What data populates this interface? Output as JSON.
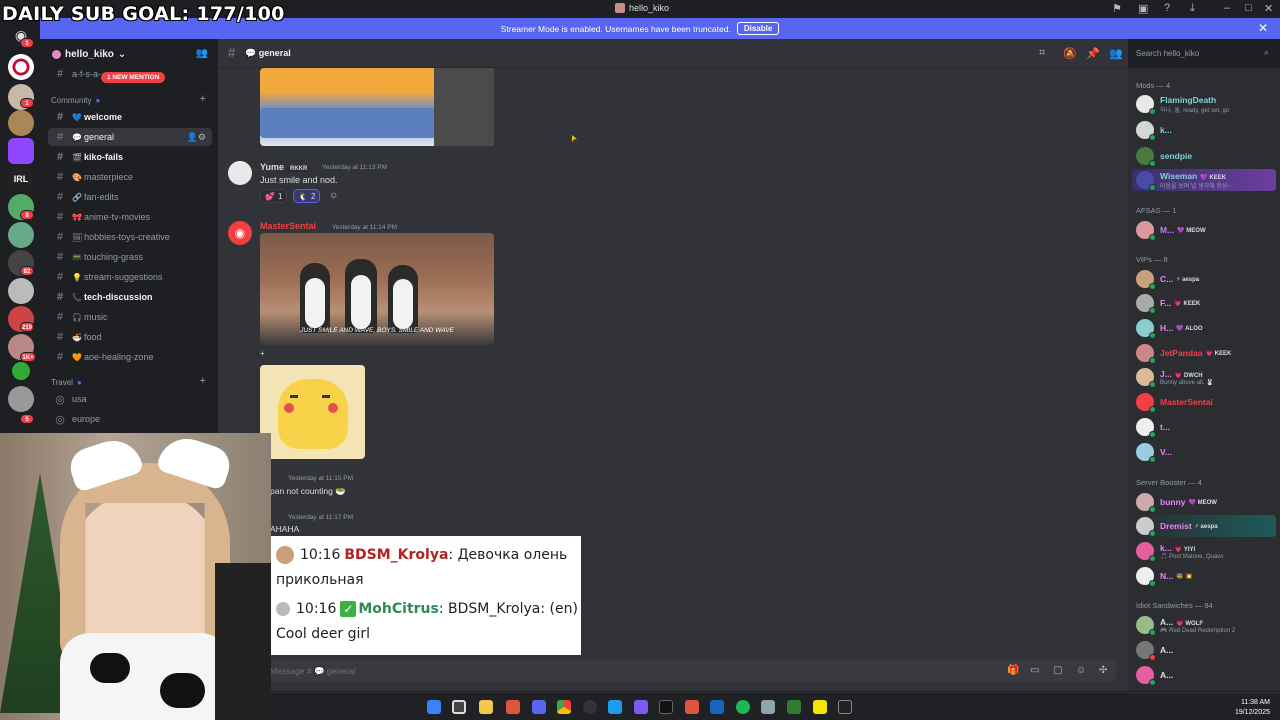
{
  "overlay_goal": "DAILY SUB GOAL: 177/100",
  "window": {
    "title": "hello_kiko"
  },
  "banner": {
    "text": "Streamer Mode is enabled. Usernames have been truncated.",
    "button": "Disable"
  },
  "server": {
    "name": "hello_kiko",
    "chevron": "⌄"
  },
  "sidebar": {
    "mention_pill": "1 NEW MENTION",
    "top_channel": "a-f-s-a-",
    "categories": {
      "community": "Community",
      "travel": "Travel"
    },
    "channels": [
      {
        "emoji": "💙",
        "label": "welcome"
      },
      {
        "emoji": "💬",
        "label": "general"
      },
      {
        "emoji": "🎬",
        "label": "kiko-fails"
      },
      {
        "emoji": "🎨",
        "label": "masterpiece"
      },
      {
        "emoji": "🔗",
        "label": "fan-edits"
      },
      {
        "emoji": "🎀",
        "label": "anime-tv-movies"
      },
      {
        "emoji": "🖼",
        "label": "hobbies-toys-creative"
      },
      {
        "emoji": "📟",
        "label": "touching-grass"
      },
      {
        "emoji": "💡",
        "label": "stream-suggestions"
      },
      {
        "emoji": "📞",
        "label": "tech-discussion"
      },
      {
        "emoji": "🎧",
        "label": "music"
      },
      {
        "emoji": "🍜",
        "label": "food"
      },
      {
        "emoji": "🧡",
        "label": "aoe-healing-zone"
      },
      {
        "emoji": "",
        "label": "usa"
      },
      {
        "emoji": "",
        "label": "europe"
      }
    ]
  },
  "server_badges": [
    "1",
    "1",
    "8",
    "82",
    "219",
    "1K+",
    "5"
  ],
  "channel_header": {
    "name": "general",
    "emoji": "💬"
  },
  "search": {
    "placeholder": "Search hello_kiko"
  },
  "messages": [
    {
      "name": "Yume",
      "tag": "RKKR",
      "time": "Yesterday at 11:13 PM",
      "text": "Just smile and nod.",
      "reactions": [
        {
          "emoji": "💕",
          "count": "1"
        },
        {
          "emoji": "🐧",
          "count": "2"
        }
      ]
    },
    {
      "name": "MasterSentai",
      "time": "Yesterday at 11:14 PM",
      "gif_caption": "JUST SMILE AND WAVE, BOYS. SMILE AND WAVE",
      "plus": "+"
    },
    {
      "time": "Yesterday at 11:15 PM",
      "text": "pan not counting 🥗"
    },
    {
      "time": "Yesterday at 11:17 PM",
      "text": "AHAHA"
    }
  ],
  "composer": {
    "placeholder": "Message # 💬 general"
  },
  "overlay_chat": [
    {
      "time": "10:16",
      "user": "BDSM_Krolya",
      "text": ": Девочка олень",
      "cont": "прикольная"
    },
    {
      "time": "10:16",
      "user": "MohCitrus",
      "text": ": BDSM_Krolya: (en)",
      "cont": "Cool deer girl"
    }
  ],
  "members": {
    "groups": [
      {
        "title": "Mods — 4"
      },
      {
        "title": "AFSAS — 1"
      },
      {
        "title": "VIPs — 8"
      },
      {
        "title": "Server Booster — 4"
      },
      {
        "title": "Idiot Sandwiches — 94"
      }
    ],
    "list": [
      {
        "name": "FlamingDeath",
        "sub": "하나, 둘, ready, get set, go",
        "color": "#7fd3d6",
        "avatar": "#e8e8e8"
      },
      {
        "name": "k...",
        "sub": "",
        "color": "#7fd3d6",
        "avatar": "#d6d6d6"
      },
      {
        "name": "sendpie",
        "sub": "",
        "color": "#7fd3d6",
        "avatar": "#4a7a3e"
      },
      {
        "name": "Wiseman",
        "badge": "💜 KEEK",
        "sub": "마음을 보며 널 생각해 항상~",
        "color": "#7fd3d6",
        "avatar": "#4a4aa8"
      },
      {
        "name": "M...",
        "badge": "💜 MEOW",
        "sub": "",
        "color": "#c77dff",
        "avatar": "#d99"
      },
      {
        "name": "C...",
        "badge": "⚡ aespa",
        "sub": "",
        "color": "#f47fff",
        "avatar": "#c9a07a"
      },
      {
        "name": "F...",
        "badge": "💗 KEEK",
        "sub": "",
        "color": "#f47fff",
        "avatar": "#aaa"
      },
      {
        "name": "H...",
        "badge": "💜 ALOO",
        "sub": "",
        "color": "#f47fff",
        "avatar": "#8cc"
      },
      {
        "name": "JetPandaa",
        "badge": "💗 KEEK",
        "sub": "",
        "color": "#f23f43",
        "avatar": "#c88"
      },
      {
        "name": "J...",
        "badge": "💗 DWCH",
        "sub": "Bunny above all. 🐰",
        "color": "#f47fff",
        "avatar": "#db9"
      },
      {
        "name": "MasterSentai",
        "sub": "",
        "color": "#f23f43",
        "avatar": "#f23f43"
      },
      {
        "name": "t...",
        "sub": "",
        "color": "#f47fff",
        "avatar": "#eee"
      },
      {
        "name": "V...",
        "sub": "",
        "color": "#f47fff",
        "avatar": "#9cd"
      },
      {
        "name": "bunny",
        "badge": "💜 MEOW",
        "sub": "",
        "color": "#f47fff",
        "avatar": "#caa"
      },
      {
        "name": "Dremist",
        "badge": "⚡ aespa",
        "sub": "",
        "color": "#f47fff",
        "avatar": "#ccc"
      },
      {
        "name": "k...",
        "badge": "💗 YIYI",
        "sub": "🎵 Post Malone, Quavo",
        "color": "#f47fff",
        "avatar": "#e55fa0"
      },
      {
        "name": "N...",
        "badge": "🐝 💥",
        "sub": "",
        "color": "#f47fff",
        "avatar": "#eee"
      },
      {
        "name": "A...",
        "badge": "💗 WOLF",
        "sub": "🎮 Red Dead Redemption 2",
        "color": "#dbdee1",
        "avatar": "#9b8"
      },
      {
        "name": "A...",
        "sub": "",
        "color": "#dbdee1",
        "avatar": "#777"
      },
      {
        "name": "A...",
        "sub": "",
        "color": "#dbdee1",
        "avatar": "#e55fa0"
      }
    ]
  },
  "taskbar": {
    "time": "11:38 AM",
    "date": "19/12/2025"
  },
  "colors": {
    "accent": "#5865f2",
    "bg": "#313338",
    "sidebar": "#2b2d31",
    "danger": "#f23f43"
  }
}
